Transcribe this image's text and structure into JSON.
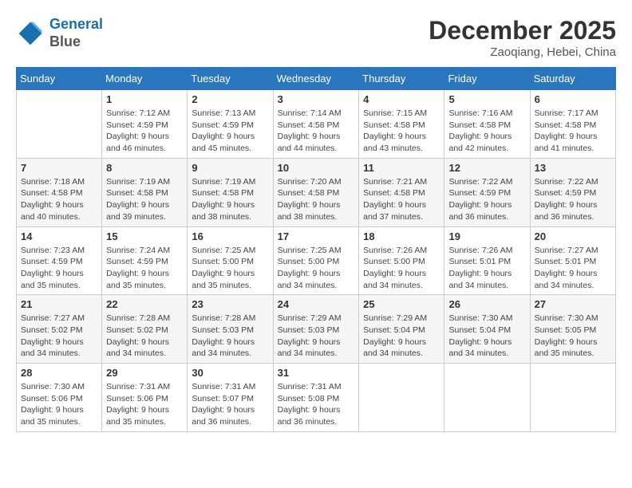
{
  "header": {
    "logo_line1": "General",
    "logo_line2": "Blue",
    "month": "December 2025",
    "location": "Zaoqiang, Hebei, China"
  },
  "days_of_week": [
    "Sunday",
    "Monday",
    "Tuesday",
    "Wednesday",
    "Thursday",
    "Friday",
    "Saturday"
  ],
  "weeks": [
    [
      {
        "num": "",
        "info": ""
      },
      {
        "num": "1",
        "info": "Sunrise: 7:12 AM\nSunset: 4:59 PM\nDaylight: 9 hours\nand 46 minutes."
      },
      {
        "num": "2",
        "info": "Sunrise: 7:13 AM\nSunset: 4:59 PM\nDaylight: 9 hours\nand 45 minutes."
      },
      {
        "num": "3",
        "info": "Sunrise: 7:14 AM\nSunset: 4:58 PM\nDaylight: 9 hours\nand 44 minutes."
      },
      {
        "num": "4",
        "info": "Sunrise: 7:15 AM\nSunset: 4:58 PM\nDaylight: 9 hours\nand 43 minutes."
      },
      {
        "num": "5",
        "info": "Sunrise: 7:16 AM\nSunset: 4:58 PM\nDaylight: 9 hours\nand 42 minutes."
      },
      {
        "num": "6",
        "info": "Sunrise: 7:17 AM\nSunset: 4:58 PM\nDaylight: 9 hours\nand 41 minutes."
      }
    ],
    [
      {
        "num": "7",
        "info": "Sunrise: 7:18 AM\nSunset: 4:58 PM\nDaylight: 9 hours\nand 40 minutes."
      },
      {
        "num": "8",
        "info": "Sunrise: 7:19 AM\nSunset: 4:58 PM\nDaylight: 9 hours\nand 39 minutes."
      },
      {
        "num": "9",
        "info": "Sunrise: 7:19 AM\nSunset: 4:58 PM\nDaylight: 9 hours\nand 38 minutes."
      },
      {
        "num": "10",
        "info": "Sunrise: 7:20 AM\nSunset: 4:58 PM\nDaylight: 9 hours\nand 38 minutes."
      },
      {
        "num": "11",
        "info": "Sunrise: 7:21 AM\nSunset: 4:58 PM\nDaylight: 9 hours\nand 37 minutes."
      },
      {
        "num": "12",
        "info": "Sunrise: 7:22 AM\nSunset: 4:59 PM\nDaylight: 9 hours\nand 36 minutes."
      },
      {
        "num": "13",
        "info": "Sunrise: 7:22 AM\nSunset: 4:59 PM\nDaylight: 9 hours\nand 36 minutes."
      }
    ],
    [
      {
        "num": "14",
        "info": "Sunrise: 7:23 AM\nSunset: 4:59 PM\nDaylight: 9 hours\nand 35 minutes."
      },
      {
        "num": "15",
        "info": "Sunrise: 7:24 AM\nSunset: 4:59 PM\nDaylight: 9 hours\nand 35 minutes."
      },
      {
        "num": "16",
        "info": "Sunrise: 7:25 AM\nSunset: 5:00 PM\nDaylight: 9 hours\nand 35 minutes."
      },
      {
        "num": "17",
        "info": "Sunrise: 7:25 AM\nSunset: 5:00 PM\nDaylight: 9 hours\nand 34 minutes."
      },
      {
        "num": "18",
        "info": "Sunrise: 7:26 AM\nSunset: 5:00 PM\nDaylight: 9 hours\nand 34 minutes."
      },
      {
        "num": "19",
        "info": "Sunrise: 7:26 AM\nSunset: 5:01 PM\nDaylight: 9 hours\nand 34 minutes."
      },
      {
        "num": "20",
        "info": "Sunrise: 7:27 AM\nSunset: 5:01 PM\nDaylight: 9 hours\nand 34 minutes."
      }
    ],
    [
      {
        "num": "21",
        "info": "Sunrise: 7:27 AM\nSunset: 5:02 PM\nDaylight: 9 hours\nand 34 minutes."
      },
      {
        "num": "22",
        "info": "Sunrise: 7:28 AM\nSunset: 5:02 PM\nDaylight: 9 hours\nand 34 minutes."
      },
      {
        "num": "23",
        "info": "Sunrise: 7:28 AM\nSunset: 5:03 PM\nDaylight: 9 hours\nand 34 minutes."
      },
      {
        "num": "24",
        "info": "Sunrise: 7:29 AM\nSunset: 5:03 PM\nDaylight: 9 hours\nand 34 minutes."
      },
      {
        "num": "25",
        "info": "Sunrise: 7:29 AM\nSunset: 5:04 PM\nDaylight: 9 hours\nand 34 minutes."
      },
      {
        "num": "26",
        "info": "Sunrise: 7:30 AM\nSunset: 5:04 PM\nDaylight: 9 hours\nand 34 minutes."
      },
      {
        "num": "27",
        "info": "Sunrise: 7:30 AM\nSunset: 5:05 PM\nDaylight: 9 hours\nand 35 minutes."
      }
    ],
    [
      {
        "num": "28",
        "info": "Sunrise: 7:30 AM\nSunset: 5:06 PM\nDaylight: 9 hours\nand 35 minutes."
      },
      {
        "num": "29",
        "info": "Sunrise: 7:31 AM\nSunset: 5:06 PM\nDaylight: 9 hours\nand 35 minutes."
      },
      {
        "num": "30",
        "info": "Sunrise: 7:31 AM\nSunset: 5:07 PM\nDaylight: 9 hours\nand 36 minutes."
      },
      {
        "num": "31",
        "info": "Sunrise: 7:31 AM\nSunset: 5:08 PM\nDaylight: 9 hours\nand 36 minutes."
      },
      {
        "num": "",
        "info": ""
      },
      {
        "num": "",
        "info": ""
      },
      {
        "num": "",
        "info": ""
      }
    ]
  ]
}
